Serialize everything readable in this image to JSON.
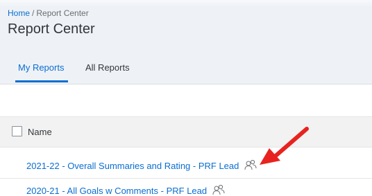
{
  "breadcrumb": {
    "home": "Home",
    "separator": "/",
    "current": "Report Center"
  },
  "page": {
    "title": "Report Center"
  },
  "tabs": [
    {
      "label": "My Reports",
      "selected": true
    },
    {
      "label": "All Reports",
      "selected": false
    }
  ],
  "table": {
    "columns": [
      {
        "label": "Name"
      }
    ],
    "rows": [
      {
        "name": "2021-22 - Overall Summaries and Rating - PRF Lead",
        "icon": "shared-users-icon"
      },
      {
        "name": "2020-21 - All Goals w Comments - PRF Lead",
        "icon": "shared-users-icon"
      }
    ]
  },
  "colors": {
    "accent": "#0a6ed1",
    "header_bg": "#eef2f6",
    "annotation_arrow": "#e8231f"
  }
}
